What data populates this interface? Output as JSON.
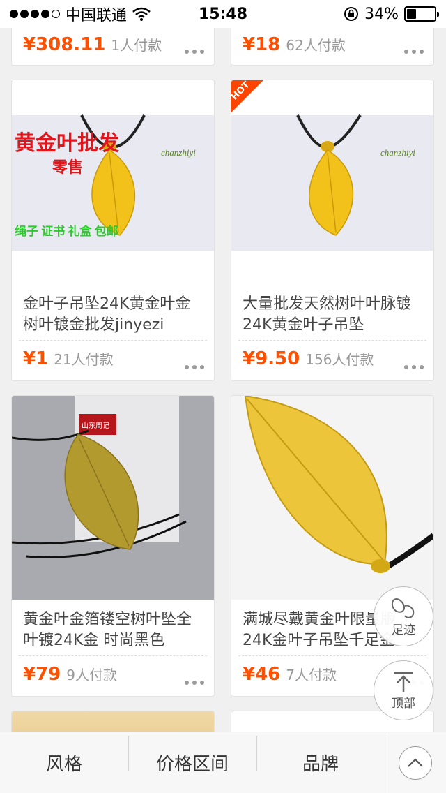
{
  "status_bar": {
    "carrier": "中国联通",
    "time": "15:48",
    "battery_percent": "34%",
    "battery_level": 0.34
  },
  "top_row": [
    {
      "price": "¥308.11",
      "sold": "1人付款"
    },
    {
      "price": "¥18",
      "sold": "62人付款"
    }
  ],
  "products": [
    {
      "title": "金叶子吊坠24K黄金叶金树叶镀金批发jinyezi",
      "price": "¥1",
      "sold": "21人付款",
      "hot": false,
      "image_text": {
        "headline": "黄金叶批发",
        "sub": "零售",
        "footer": "绳子 证书 礼盒 包邮",
        "brand": "chanzhiyi"
      }
    },
    {
      "title": "大量批发天然树叶叶脉镀24K黄金叶子吊坠",
      "price": "¥9.50",
      "sold": "156人付款",
      "hot": true,
      "hot_label": "HOT",
      "image_text": {
        "brand": "chanzhiyi"
      }
    },
    {
      "title": "黄金叶金箔镂空树叶坠全叶镀24K金 时尚黑色",
      "price": "¥79",
      "sold": "9人付款",
      "hot": false,
      "image_text": {
        "box_label": "山东周记"
      }
    },
    {
      "title": "满城尽戴黄金叶限量版24K金叶子吊坠千足金",
      "price": "¥46",
      "sold": "7人付款",
      "hot": false
    }
  ],
  "floating": {
    "footprint_label": "足迹",
    "top_label": "顶部"
  },
  "bottom_bar": {
    "items": [
      "风格",
      "价格区间",
      "品牌"
    ]
  },
  "colors": {
    "price": "#ff5000",
    "hot": "#ff4400",
    "gold": "#f2c21a"
  }
}
